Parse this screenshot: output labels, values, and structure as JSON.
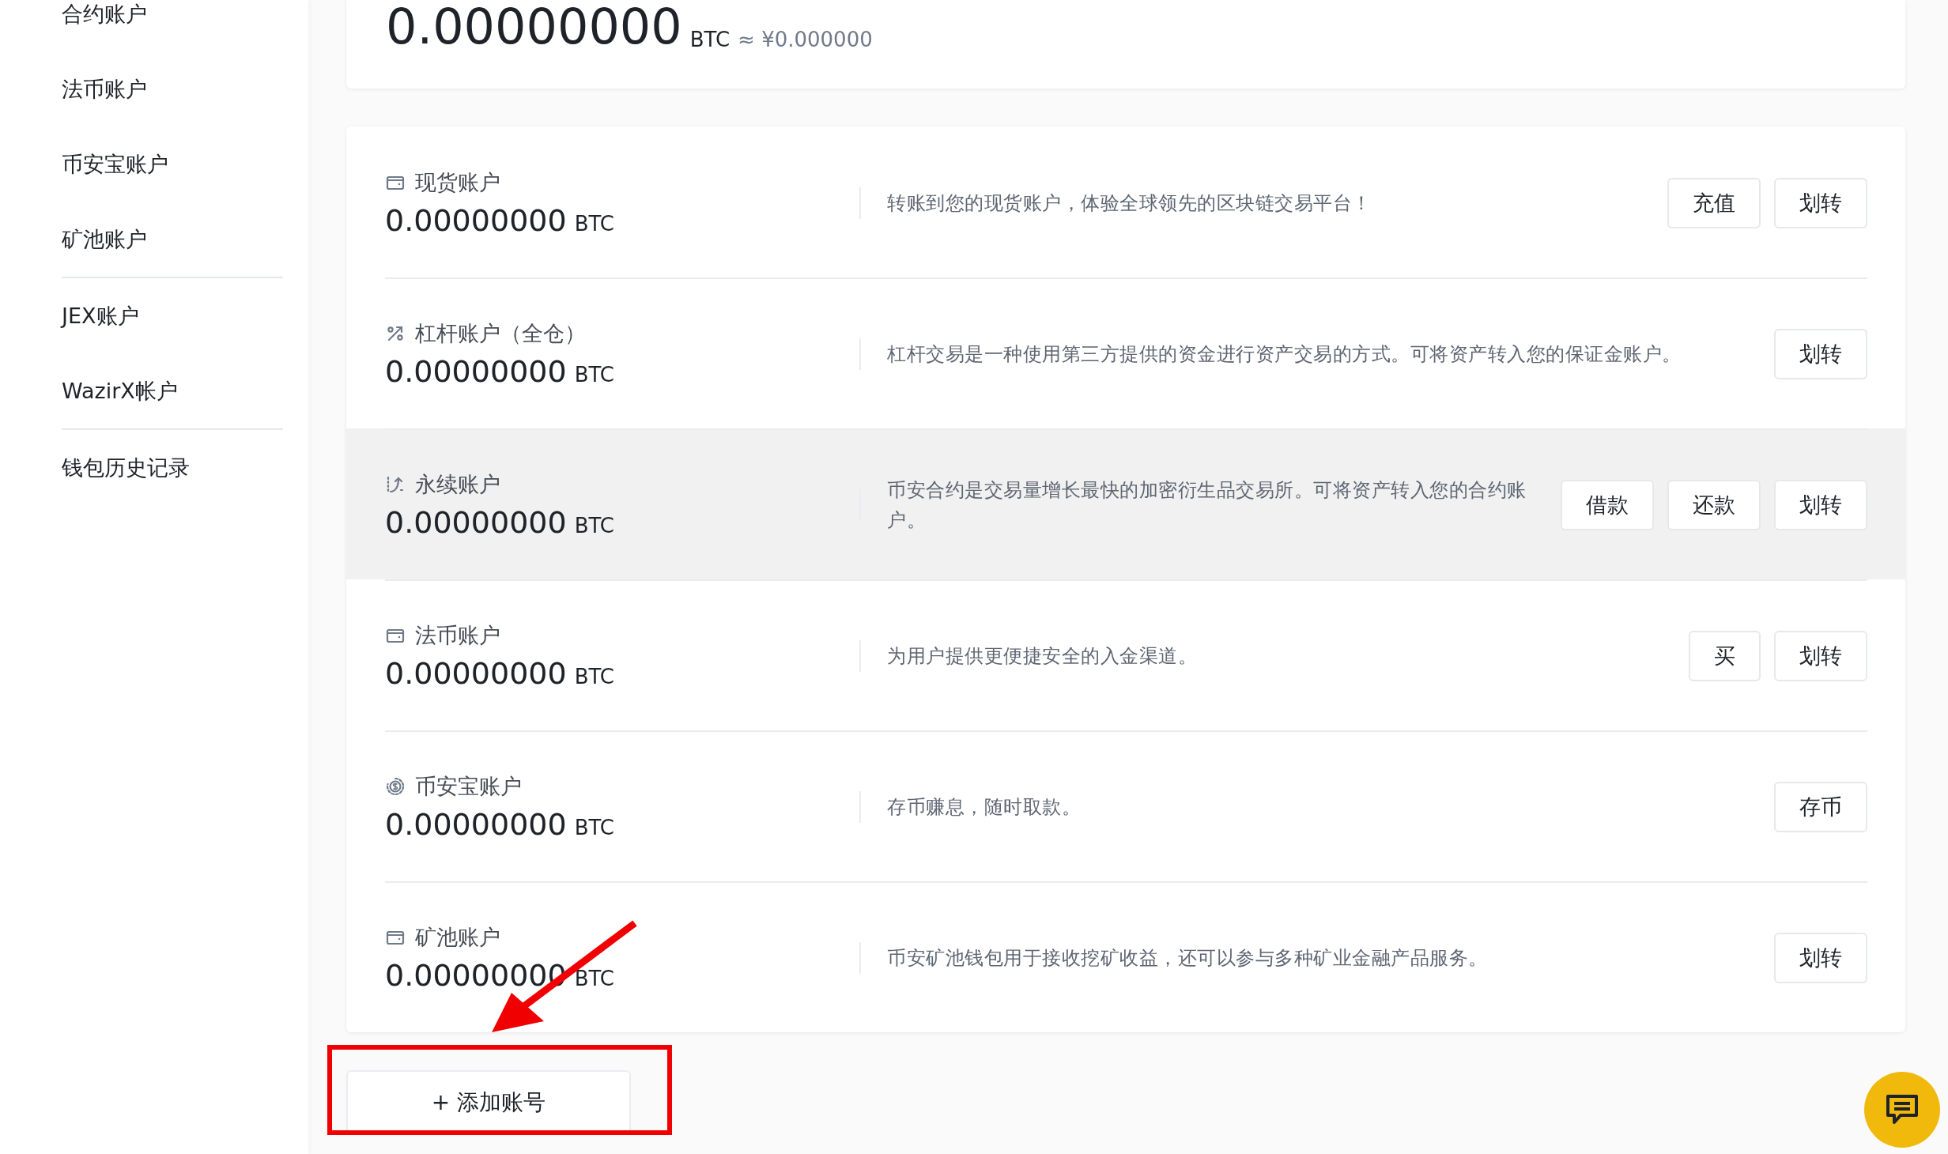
{
  "sidebar": {
    "groups": [
      {
        "items": [
          {
            "label": "合约账户",
            "selected": false
          },
          {
            "label": "法币账户",
            "selected": false
          },
          {
            "label": "币安宝账户",
            "selected": false
          },
          {
            "label": "矿池账户",
            "selected": false
          }
        ]
      },
      {
        "items": [
          {
            "label": "JEX账户",
            "selected": false
          },
          {
            "label": "WazirX帐户",
            "selected": false
          }
        ]
      },
      {
        "items": [
          {
            "label": "钱包历史记录",
            "selected": false
          }
        ]
      }
    ]
  },
  "total": {
    "amount": "0.00000000",
    "unit": "BTC",
    "approx": "≈ ¥0.000000"
  },
  "accounts": [
    {
      "kind": "wallet",
      "name": "现货账户",
      "amount": "0.00000000",
      "unit": "BTC",
      "description": "转账到您的现货账户，体验全球领先的区块链交易平台！",
      "highlighted": false,
      "buttons": [
        "充值",
        "划转"
      ]
    },
    {
      "kind": "margin",
      "name": "杠杆账户（全仓）",
      "amount": "0.00000000",
      "unit": "BTC",
      "description": "杠杆交易是一种使用第三方提供的资金进行资产交易的方式。可将资产转入您的保证金账户。",
      "highlighted": false,
      "buttons": [
        "划转"
      ]
    },
    {
      "kind": "futures",
      "name": "永续账户",
      "amount": "0.00000000",
      "unit": "BTC",
      "description": "币安合约是交易量增长最快的加密衍生品交易所。可将资产转入您的合约账户。",
      "highlighted": true,
      "buttons": [
        "借款",
        "还款",
        "划转"
      ]
    },
    {
      "kind": "wallet",
      "name": "法币账户",
      "amount": "0.00000000",
      "unit": "BTC",
      "description": "为用户提供更便捷安全的入金渠道。",
      "highlighted": false,
      "buttons": [
        "买",
        "划转"
      ]
    },
    {
      "kind": "savings",
      "name": "币安宝账户",
      "amount": "0.00000000",
      "unit": "BTC",
      "description": "存币赚息，随时取款。",
      "highlighted": false,
      "buttons": [
        "存币"
      ]
    },
    {
      "kind": "wallet",
      "name": "矿池账户",
      "amount": "0.00000000",
      "unit": "BTC",
      "description": "币安矿池钱包用于接收挖矿收益，还可以参与多种矿业金融产品服务。",
      "highlighted": false,
      "buttons": [
        "划转"
      ]
    }
  ],
  "add_account_button": "+ 添加账号",
  "annotation": {
    "kind": "box-arrow"
  },
  "chat_button": {
    "kind": "chat"
  }
}
